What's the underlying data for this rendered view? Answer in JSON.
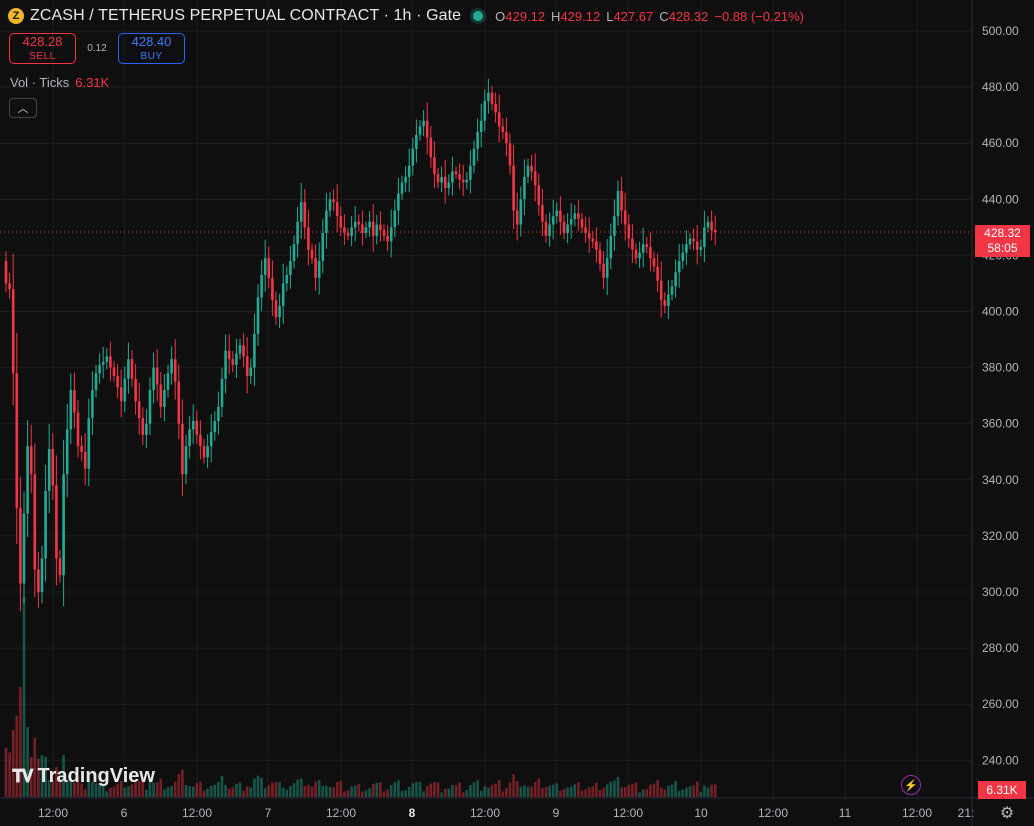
{
  "header": {
    "coin_icon": "zcash-coin-icon",
    "title": "ZCASH / TETHERUS PERPETUAL CONTRACT · 1h · Gate",
    "ohlc": {
      "o_label": "O",
      "o": "429.12",
      "h_label": "H",
      "h": "429.12",
      "l_label": "L",
      "l": "427.67",
      "c_label": "C",
      "c": "428.32",
      "change": "−0.88 (−0.21%)"
    }
  },
  "trade": {
    "sell_price": "428.28",
    "sell_label": "SELL",
    "spread": "0.12",
    "buy_price": "428.40",
    "buy_label": "BUY"
  },
  "volume_legend": {
    "label": "Vol · Ticks",
    "value": "6.31K"
  },
  "collapse_icon": "chevron-up-icon",
  "price_axis": {
    "ticks": [
      "500.00",
      "480.00",
      "460.00",
      "440.00",
      "420.00",
      "400.00",
      "380.00",
      "360.00",
      "340.00",
      "320.00",
      "300.00",
      "280.00",
      "260.00",
      "240.00"
    ],
    "current_price": "428.32",
    "countdown": "58:05",
    "volume_value": "6.31K"
  },
  "time_axis": {
    "ticks": [
      "12:00",
      "6",
      "12:00",
      "7",
      "12:00",
      "8",
      "12:00",
      "9",
      "12:00",
      "10",
      "12:00",
      "11",
      "12:00",
      "21:"
    ]
  },
  "branding": {
    "logo_text": "TradingView"
  },
  "colors": {
    "up": "#22ab94",
    "down": "#f23645",
    "background": "#0f0f0f",
    "grid": "#1e1e1e"
  },
  "chart_data": {
    "type": "candlestick",
    "title": "ZCASH / TETHERUS PERPETUAL CONTRACT · 1h · Gate",
    "interval": "1h",
    "ylim": [
      230,
      505
    ],
    "last_price": 428.32,
    "grid": true,
    "closes": [
      410,
      408,
      378,
      330,
      303,
      328,
      352,
      342,
      308,
      300,
      312,
      336,
      351,
      338,
      312,
      306,
      342,
      358,
      372,
      364,
      352,
      350,
      344,
      362,
      372,
      378,
      381,
      382,
      384,
      380,
      377,
      373,
      368,
      376,
      383,
      376,
      368,
      362,
      356,
      360,
      372,
      380,
      374,
      366,
      372,
      378,
      383,
      375,
      360,
      342,
      352,
      358,
      361,
      356,
      352,
      348,
      352,
      357,
      361,
      366,
      376,
      386,
      383,
      381,
      385,
      388,
      384,
      377,
      380,
      392,
      405,
      413,
      419,
      412,
      404,
      398,
      402,
      410,
      413,
      418,
      424,
      432,
      439,
      430,
      422,
      419,
      412,
      418,
      428,
      436,
      440,
      439,
      434,
      430,
      428,
      427,
      430,
      432,
      431,
      428,
      430,
      432,
      427,
      431,
      429,
      427,
      425,
      430,
      436,
      442,
      446,
      448,
      452,
      458,
      463,
      466,
      468,
      462,
      455,
      449,
      446,
      448,
      444,
      446,
      450,
      449,
      447,
      446,
      447,
      452,
      458,
      464,
      468,
      475,
      478,
      474,
      471,
      466,
      464,
      460,
      452,
      436,
      431,
      440,
      448,
      452,
      450,
      445,
      438,
      432,
      427,
      431,
      434,
      436,
      432,
      428,
      431,
      433,
      435,
      433,
      430,
      428,
      426,
      425,
      422,
      417,
      412,
      419,
      427,
      434,
      443,
      436,
      431,
      426,
      422,
      419,
      421,
      424,
      423,
      419,
      416,
      411,
      404,
      402,
      406,
      409,
      414,
      418,
      421,
      424,
      426,
      425,
      422,
      423,
      430,
      432,
      429,
      428.32
    ]
  }
}
